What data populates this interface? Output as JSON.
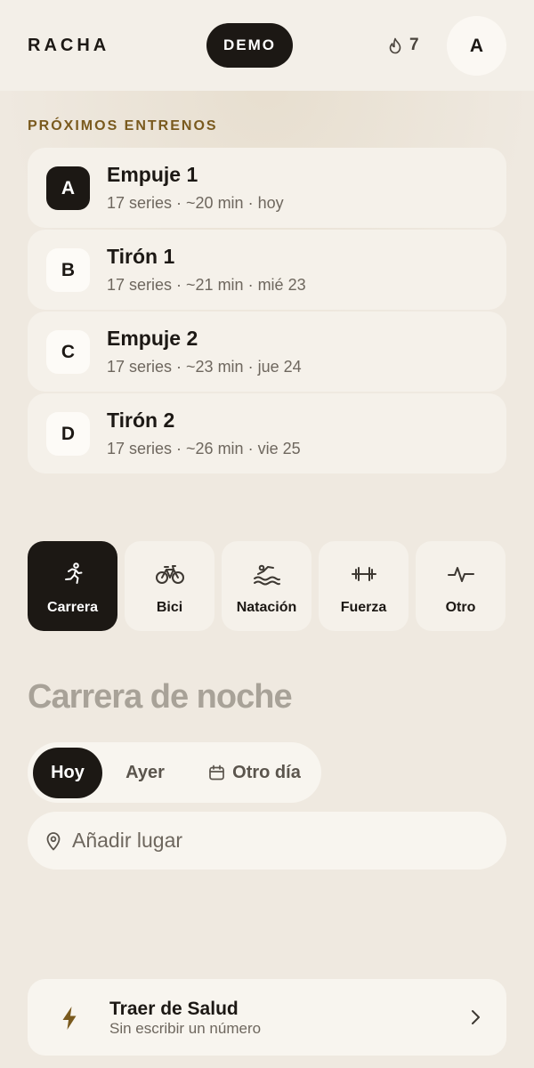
{
  "header": {
    "brand": "RACHA",
    "demo_label": "DEMO",
    "streak_count": "7",
    "avatar_initial": "A"
  },
  "upcoming": {
    "label": "PRÓXIMOS ENTRENOS",
    "items": [
      {
        "badge": "A",
        "title": "Empuje 1",
        "subtitle": "17 series · ~20 min · hoy",
        "active": true
      },
      {
        "badge": "B",
        "title": "Tirón 1",
        "subtitle": "17 series · ~21 min · mié 23",
        "active": false
      },
      {
        "badge": "C",
        "title": "Empuje 2",
        "subtitle": "17 series · ~23 min · jue 24",
        "active": false
      },
      {
        "badge": "D",
        "title": "Tirón 2",
        "subtitle": "17 series · ~26 min · vie 25",
        "active": false
      }
    ]
  },
  "activity_types": [
    {
      "label": "Carrera",
      "icon": "running-icon",
      "selected": true
    },
    {
      "label": "Bici",
      "icon": "bicycle-icon",
      "selected": false
    },
    {
      "label": "Natación",
      "icon": "swimming-icon",
      "selected": false
    },
    {
      "label": "Fuerza",
      "icon": "dumbbell-icon",
      "selected": false
    },
    {
      "label": "Otro",
      "icon": "pulse-icon",
      "selected": false
    }
  ],
  "activity_title": {
    "placeholder": "Carrera de noche",
    "value": ""
  },
  "day_selector": {
    "options": [
      "Hoy",
      "Ayer",
      "Otro día"
    ],
    "selected": "Hoy"
  },
  "place": {
    "placeholder": "Añadir lugar"
  },
  "health_import": {
    "title": "Traer de Salud",
    "subtitle": "Sin escribir un número"
  },
  "colors": {
    "background": "#efe9e0",
    "dark": "#1c1814",
    "card": "#f5f1ea",
    "accent_gold": "#7a5a1e",
    "muted_text": "#6e675e"
  }
}
